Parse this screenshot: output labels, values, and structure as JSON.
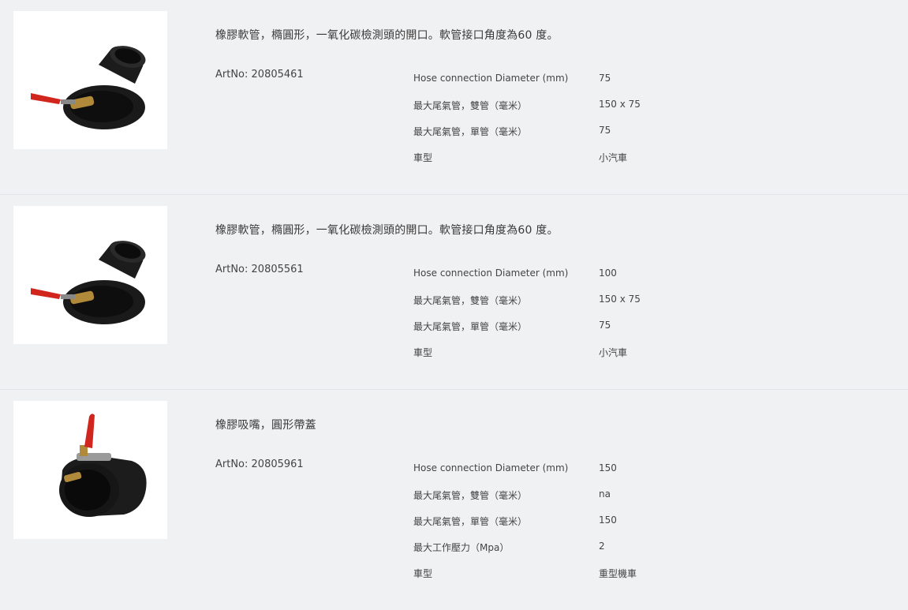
{
  "products": [
    {
      "image_icon": "oval-rubber-nozzle-60deg-icon",
      "title": "橡膠軟管，橢圓形，一氧化碳檢測頭的開口。軟管接口角度為60 度。",
      "artno": "ArtNo: 20805461",
      "specs": [
        {
          "label": "Hose connection Diameter (mm)",
          "value": "75"
        },
        {
          "label": "最大尾氣管，雙管（毫米）",
          "value": "150 x 75"
        },
        {
          "label": "最大尾氣管，單管（毫米）",
          "value": "75"
        },
        {
          "label": "車型",
          "value": "小汽車"
        }
      ]
    },
    {
      "image_icon": "oval-rubber-nozzle-60deg-icon",
      "title": "橡膠軟管，橢圓形，一氧化碳檢測頭的開口。軟管接口角度為60 度。",
      "artno": "ArtNo: 20805561",
      "specs": [
        {
          "label": "Hose connection Diameter (mm)",
          "value": "100"
        },
        {
          "label": "最大尾氣管，雙管（毫米）",
          "value": "150 x 75"
        },
        {
          "label": "最大尾氣管，單管（毫米）",
          "value": "75"
        },
        {
          "label": "車型",
          "value": "小汽車"
        }
      ]
    },
    {
      "image_icon": "round-rubber-nozzle-with-cover-icon",
      "title": "橡膠吸嘴，圓形帶蓋",
      "artno": "ArtNo: 20805961",
      "specs": [
        {
          "label": "Hose connection Diameter (mm)",
          "value": "150"
        },
        {
          "label": "最大尾氣管，雙管（毫米）",
          "value": "na"
        },
        {
          "label": "最大尾氣管，單管（毫米）",
          "value": "150"
        },
        {
          "label": "最大工作壓力（Mpa）",
          "value": "2"
        },
        {
          "label": "車型",
          "value": "重型機車"
        }
      ]
    }
  ]
}
